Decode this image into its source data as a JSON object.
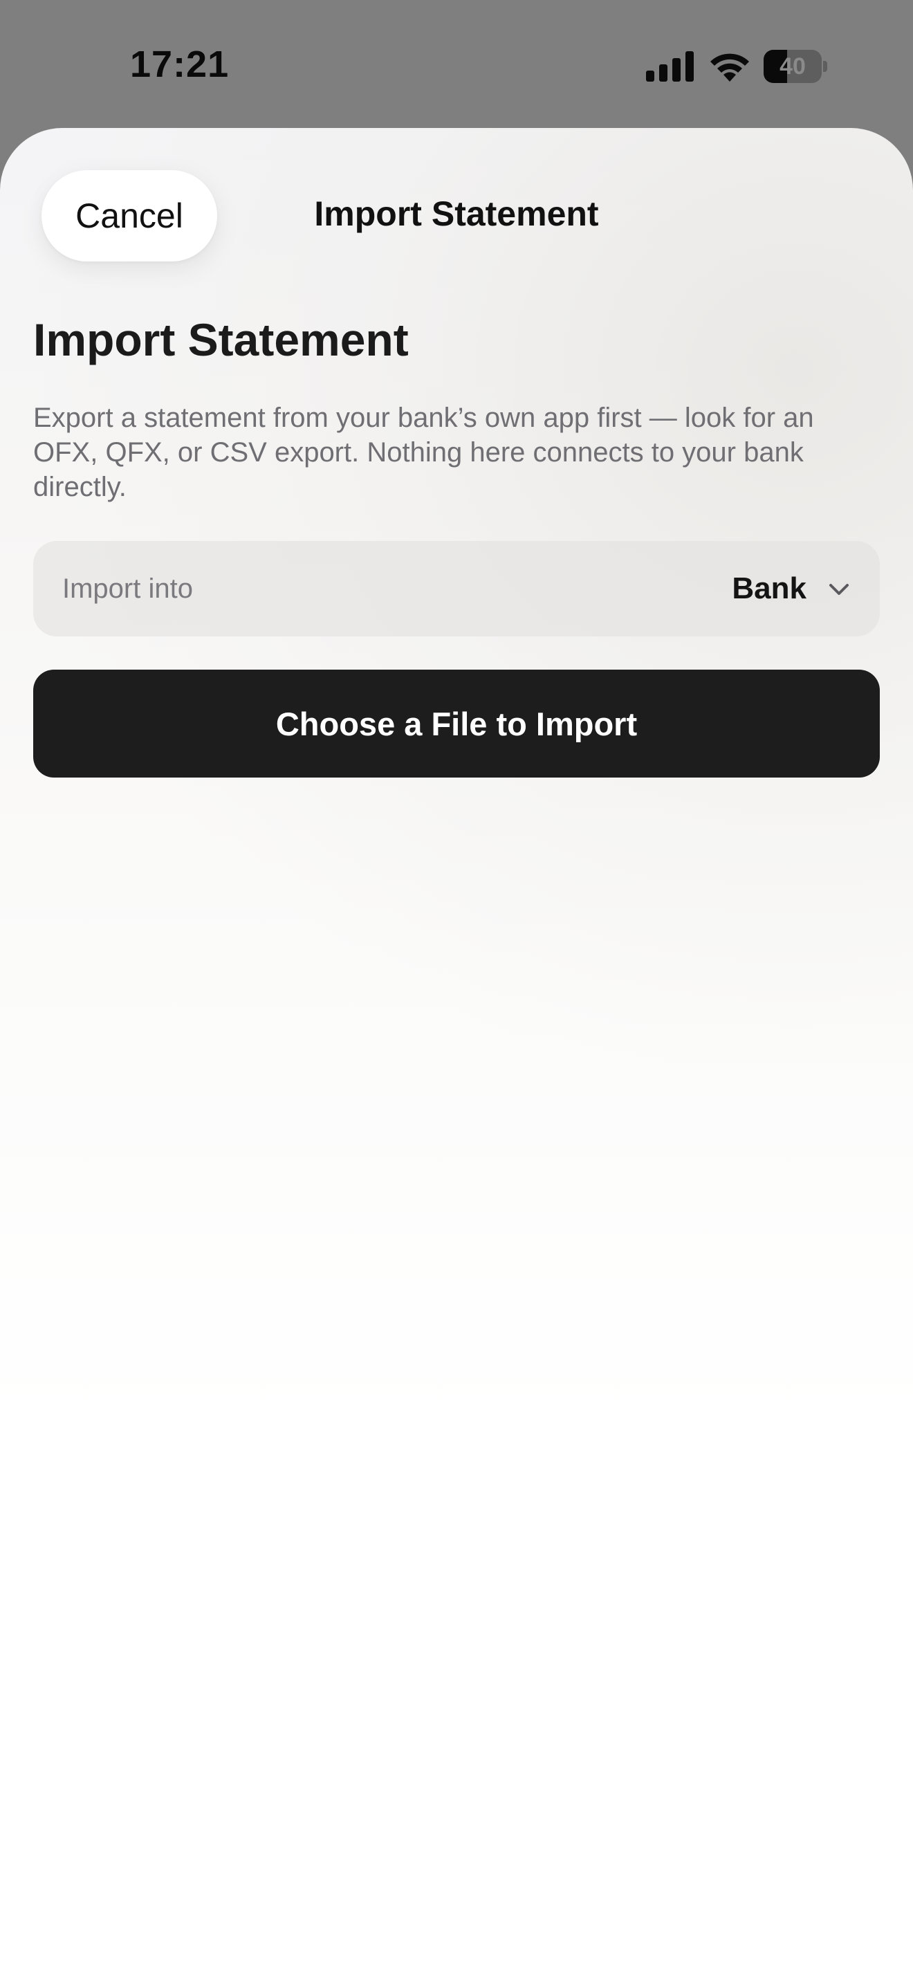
{
  "status_bar": {
    "time": "17:21",
    "battery_level": "40",
    "battery_fraction": 0.4,
    "icons": [
      "signal-icon",
      "wifi-icon",
      "battery-icon"
    ]
  },
  "nav": {
    "cancel_label": "Cancel",
    "title": "Import Statement"
  },
  "content": {
    "heading": "Import Statement",
    "description": "Export a statement from your bank’s own app first — look for an OFX, QFX, or CSV export. Nothing here connects to your bank directly.",
    "import_into": {
      "label": "Import into",
      "value": "Bank",
      "icon": "chevron-down-icon"
    },
    "choose_file_label": "Choose a File to Import"
  },
  "colors": {
    "primary_button": "#1d1d1d",
    "text_primary": "#111111",
    "text_secondary": "#6e6e73"
  }
}
